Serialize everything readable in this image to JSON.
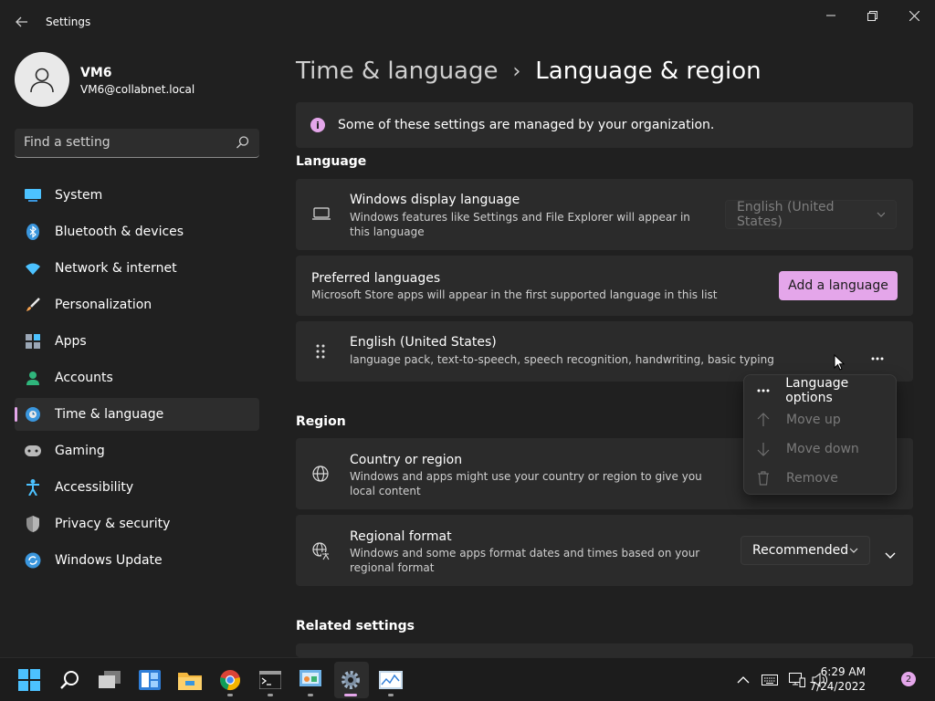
{
  "window": {
    "title": "Settings",
    "back_icon": "back-arrow-icon",
    "controls": [
      "minimize-icon",
      "restore-icon",
      "close-icon"
    ]
  },
  "profile": {
    "name": "VM6",
    "email": "VM6@collabnet.local",
    "avatar_icon": "person-icon"
  },
  "search": {
    "placeholder": "Find a setting",
    "icon": "search-icon"
  },
  "sidebar": {
    "items": [
      {
        "label": "System",
        "icon": "system-icon",
        "active": false
      },
      {
        "label": "Bluetooth & devices",
        "icon": "bluetooth-icon",
        "active": false
      },
      {
        "label": "Network & internet",
        "icon": "wifi-icon",
        "active": false
      },
      {
        "label": "Personalization",
        "icon": "brush-icon",
        "active": false
      },
      {
        "label": "Apps",
        "icon": "apps-icon",
        "active": false
      },
      {
        "label": "Accounts",
        "icon": "accounts-icon",
        "active": false
      },
      {
        "label": "Time & language",
        "icon": "time-language-icon",
        "active": true
      },
      {
        "label": "Gaming",
        "icon": "gamepad-icon",
        "active": false
      },
      {
        "label": "Accessibility",
        "icon": "accessibility-icon",
        "active": false
      },
      {
        "label": "Privacy & security",
        "icon": "shield-icon",
        "active": false
      },
      {
        "label": "Windows Update",
        "icon": "windows-update-icon",
        "active": false
      }
    ]
  },
  "main": {
    "breadcrumb": {
      "parent": "Time & language",
      "separator": "›",
      "current": "Language & region"
    },
    "info_bar": {
      "text": "Some of these settings are managed by your organization.",
      "icon": "info-icon"
    },
    "language_section": {
      "header": "Language",
      "display_language": {
        "title": "Windows display language",
        "description": "Windows features like Settings and File Explorer will appear in this language",
        "value": "English (United States)",
        "icon": "laptop-icon"
      },
      "preferred_languages": {
        "title": "Preferred languages",
        "description": "Microsoft Store apps will appear in the first supported language in this list",
        "button": "Add a language"
      },
      "language_item": {
        "title": "English (United States)",
        "description": "language pack, text-to-speech, speech recognition, handwriting, basic typing",
        "icon": "drag-handle-icon",
        "more_icon": "more-icon"
      }
    },
    "context_menu": {
      "items": [
        {
          "label": "Language options",
          "icon": "more-icon",
          "enabled": true
        },
        {
          "label": "Move up",
          "icon": "arrow-up-icon",
          "enabled": false
        },
        {
          "label": "Move down",
          "icon": "arrow-down-icon",
          "enabled": false
        },
        {
          "label": "Remove",
          "icon": "trash-icon",
          "enabled": false
        }
      ]
    },
    "region_section": {
      "header": "Region",
      "country": {
        "title": "Country or region",
        "description": "Windows and apps might use your country or region to give you local content",
        "icon": "globe-icon"
      },
      "regional_format": {
        "title": "Regional format",
        "description": "Windows and some apps format dates and times based on your regional format",
        "value": "Recommended",
        "icon": "regional-format-icon"
      }
    },
    "related_settings": {
      "header": "Related settings"
    }
  },
  "taskbar": {
    "apps": [
      "start-icon",
      "search-icon",
      "task-view-icon",
      "widgets-icon",
      "file-explorer-icon",
      "chrome-icon",
      "terminal-icon",
      "control-panel-icon",
      "settings-icon",
      "performance-monitor-icon"
    ],
    "tray_icons": [
      "chevron-up-icon",
      "keyboard-icon",
      "network-icon",
      "volume-icon"
    ],
    "time": "6:29 AM",
    "date": "7/24/2022",
    "notification_count": "2"
  },
  "colors": {
    "accent": "#e4a6ea",
    "background": "#202020",
    "card": "#2b2b2b"
  }
}
